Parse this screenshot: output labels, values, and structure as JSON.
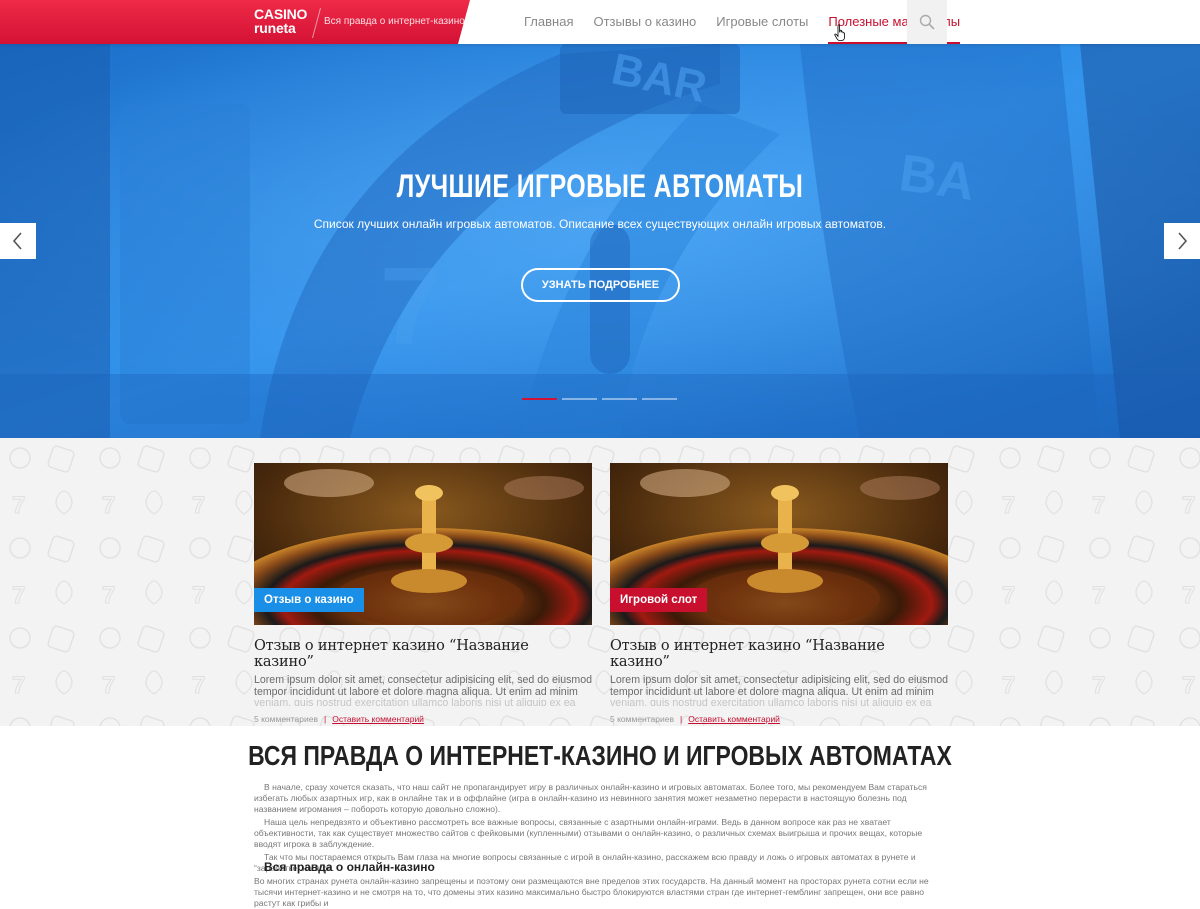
{
  "header": {
    "logo_line1": "CASINO",
    "logo_line2": "runeta",
    "tagline": "Вся правда о интернет-казино",
    "nav": [
      {
        "label": "Главная"
      },
      {
        "label": "Отзывы о казино"
      },
      {
        "label": "Игровые слоты"
      },
      {
        "label": "Полезные материалы",
        "active": true
      }
    ],
    "search_icon": "search-icon"
  },
  "hero": {
    "title": "ЛУЧШИЕ ИГРОВЫЕ АВТОМАТЫ",
    "subtitle": "Список лучших онлайн игровых автоматов. Описание всех существующих онлайн игровых автоматов.",
    "button": "УЗНАТЬ ПОДРОБНЕЕ",
    "prev_icon": "chevron-left-icon",
    "next_icon": "chevron-right-icon",
    "slides_count": 4,
    "active_slide": 1
  },
  "cards": [
    {
      "tag": "Отзыв о казино",
      "tag_color": "#1a8fe8",
      "title": "Отзыв о интернет казино “Название казино”",
      "text": "Lorem ipsum dolor sit amet, consectetur adipisicing elit, sed do eiusmod tempor incididunt ut labore et dolore magna aliqua. Ut enim ad minim",
      "text_fade": "veniam, quis nostrud exercitation ullamco laboris nisi ut aliquip ex ea",
      "comments": "5 комментариев",
      "leave_comment": "Оставить комментарий"
    },
    {
      "tag": "Игровой слот",
      "tag_color": "#c8102e",
      "title": "Отзыв о интернет казино “Название казино”",
      "text": "Lorem ipsum dolor sit amet, consectetur adipisicing elit, sed do eiusmod tempor incididunt ut labore et dolore magna aliqua. Ut enim ad minim",
      "text_fade": "veniam, quis nostrud exercitation ullamco laboris nisi ut aliquip ex ea",
      "comments": "5 комментариев",
      "leave_comment": "Оставить комментарий"
    }
  ],
  "content": {
    "title": "ВСЯ ПРАВДА О ИНТЕРНЕТ-КАЗИНО И ИГРОВЫХ АВТОМАТАХ",
    "paragraphs": [
      "В начале, сразу хочется сказать, что наш сайт не пропагандирует игру в различных онлайн-казино и игровых автоматах. Более того, мы рекомендуем Вам стараться избегать любых азартных игр, как в онлайне так и в оффлайне (игра в онлайн-казино из невинного занятия может незаметно  перерасти в настоящую болезнь под названием игромания – побороть которую довольно сложно).",
      "Наша цель непредвзято и объективно рассмотреть все важные вопросы, связанные с азартными онлайн-играми. Ведь в данном вопросе как раз не хватает объективности, так как существует множество сайтов с фейковыми (купленными) отзывами о онлайн-казино, о различных схемах выигрыша и прочих вещах, которые вводят игрока в заблуждение.",
      "Так что мы постараемся открыть Вам глаза на многие вопросы связанные с игрой в онлайн-казино, расскажем всю правду и ложь о игровых автоматах в рунете и “заработке” на игре."
    ],
    "subtitle": "Вся правда о онлайн-казино",
    "paragraph2": "Во многих странах рунета онлайн-казино запрещены и поэтому они размещаются вне пределов этих государств.  На данный момент на просторах рунета сотни если не тысячи интернет-казино и не смотря на то, что домены этих казино максимально быстро блокируются властями стран где интернет-гемблинг запрещен, они все равно растут как грибы и"
  }
}
